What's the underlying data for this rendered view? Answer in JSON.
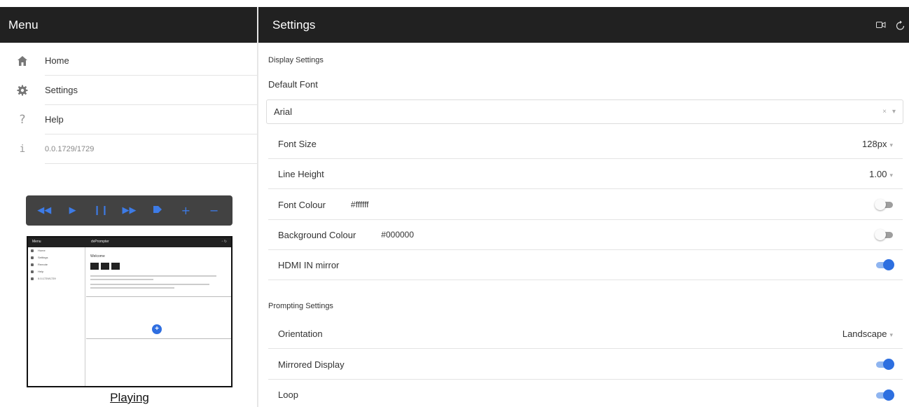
{
  "menu": {
    "title": "Menu",
    "items": [
      {
        "label": "Home",
        "icon": "home-icon"
      },
      {
        "label": "Settings",
        "icon": "gear-icon"
      },
      {
        "label": "Help",
        "icon": "question-icon"
      },
      {
        "label": "0.0.1729/1729",
        "icon": "info-icon"
      }
    ]
  },
  "controls": {
    "buttons": [
      "rewind-icon",
      "play-icon",
      "pause-icon",
      "fast-forward-icon",
      "stop-icon",
      "plus-icon",
      "minus-icon"
    ],
    "accent": "#3d7be6"
  },
  "preview": {
    "menu_title": "Menu",
    "app_title": "dvPrompter",
    "welcome": "Welcome",
    "items": [
      "Home",
      "Settings",
      "Remote",
      "Help",
      "0.0.1729/1729"
    ],
    "status": "Playing"
  },
  "header": {
    "title": "Settings",
    "icons": [
      "video-icon",
      "refresh-icon"
    ]
  },
  "display_settings": {
    "section_title": "Display Settings",
    "default_font_label": "Default Font",
    "default_font_value": "Arial",
    "font_size": {
      "label": "Font Size",
      "value": "128px"
    },
    "line_height": {
      "label": "Line Height",
      "value": "1.00"
    },
    "font_colour": {
      "label": "Font Colour",
      "hex": "#ffffff",
      "enabled": false
    },
    "background_colour": {
      "label": "Background Colour",
      "hex": "#000000",
      "enabled": false
    },
    "hdmi_mirror": {
      "label": "HDMI IN mirror",
      "enabled": true
    }
  },
  "prompting_settings": {
    "section_title": "Prompting Settings",
    "orientation": {
      "label": "Orientation",
      "value": "Landscape"
    },
    "mirrored_display": {
      "label": "Mirrored Display",
      "enabled": true
    },
    "loop": {
      "label": "Loop",
      "enabled": true
    }
  },
  "colors": {
    "header_bg": "#212121",
    "toggle_on": "#2d6fe0",
    "controls_bg": "#424242"
  }
}
